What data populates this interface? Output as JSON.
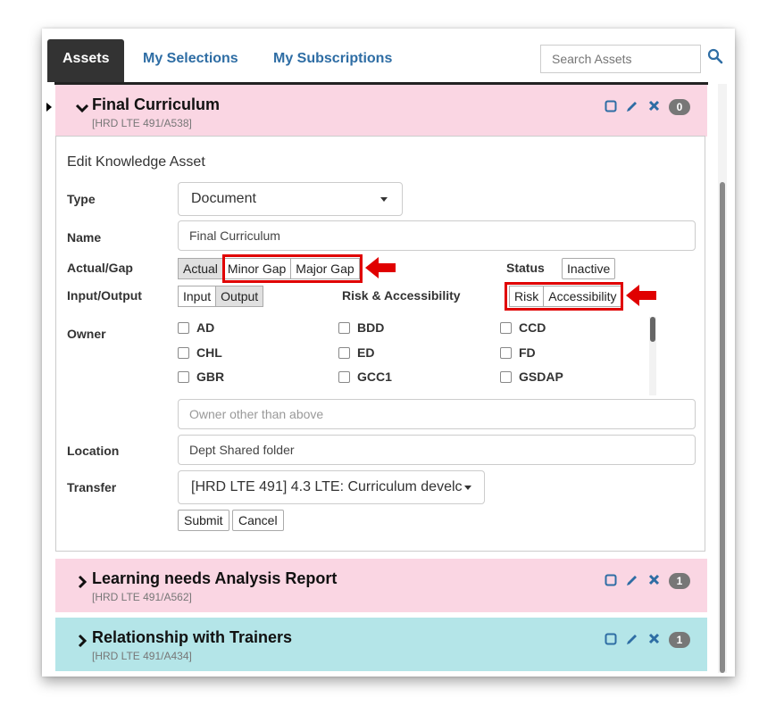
{
  "tabs": {
    "assets": "Assets",
    "my_selections": "My Selections",
    "my_subscriptions": "My Subscriptions"
  },
  "search": {
    "placeholder": "Search Assets",
    "icon": "search-icon"
  },
  "colors": {
    "link": "#2e6da4",
    "pink_header": "#fad6e3",
    "teal_header": "#b4e5e8",
    "highlight_red": "#e00000"
  },
  "assets": [
    {
      "title": "Final Curriculum",
      "code": "[HRD LTE 491/A538]",
      "count": "0",
      "expanded": true
    },
    {
      "title": "Learning needs Analysis Report",
      "code": "[HRD LTE 491/A562]",
      "count": "1",
      "expanded": false
    },
    {
      "title": "Relationship with Trainers",
      "code": "[HRD LTE 491/A434]",
      "count": "1",
      "expanded": false
    }
  ],
  "form": {
    "title": "Edit Knowledge Asset",
    "type": {
      "label": "Type",
      "value": "Document"
    },
    "name": {
      "label": "Name",
      "value": "Final Curriculum"
    },
    "actual_gap": {
      "label": "Actual/Gap",
      "options": [
        "Actual",
        "Minor Gap",
        "Major Gap"
      ],
      "selected": "Actual"
    },
    "status": {
      "label": "Status",
      "value": "Inactive"
    },
    "input_output": {
      "label": "Input/Output",
      "options": [
        "Input",
        "Output"
      ],
      "selected": "Output"
    },
    "risk_access": {
      "label": "Risk & Accessibility",
      "options": [
        "Risk",
        "Accessibility"
      ]
    },
    "owner": {
      "label": "Owner",
      "options": [
        "AD",
        "BDD",
        "CCD",
        "CHL",
        "ED",
        "FD",
        "GBR",
        "GCC1",
        "GSDAP"
      ],
      "other_placeholder": "Owner other than above"
    },
    "location": {
      "label": "Location",
      "value": "Dept Shared folder"
    },
    "transfer": {
      "label": "Transfer",
      "value": "[HRD LTE 491] 4.3 LTE: Curriculum develc"
    },
    "submit": "Submit",
    "cancel": "Cancel"
  }
}
